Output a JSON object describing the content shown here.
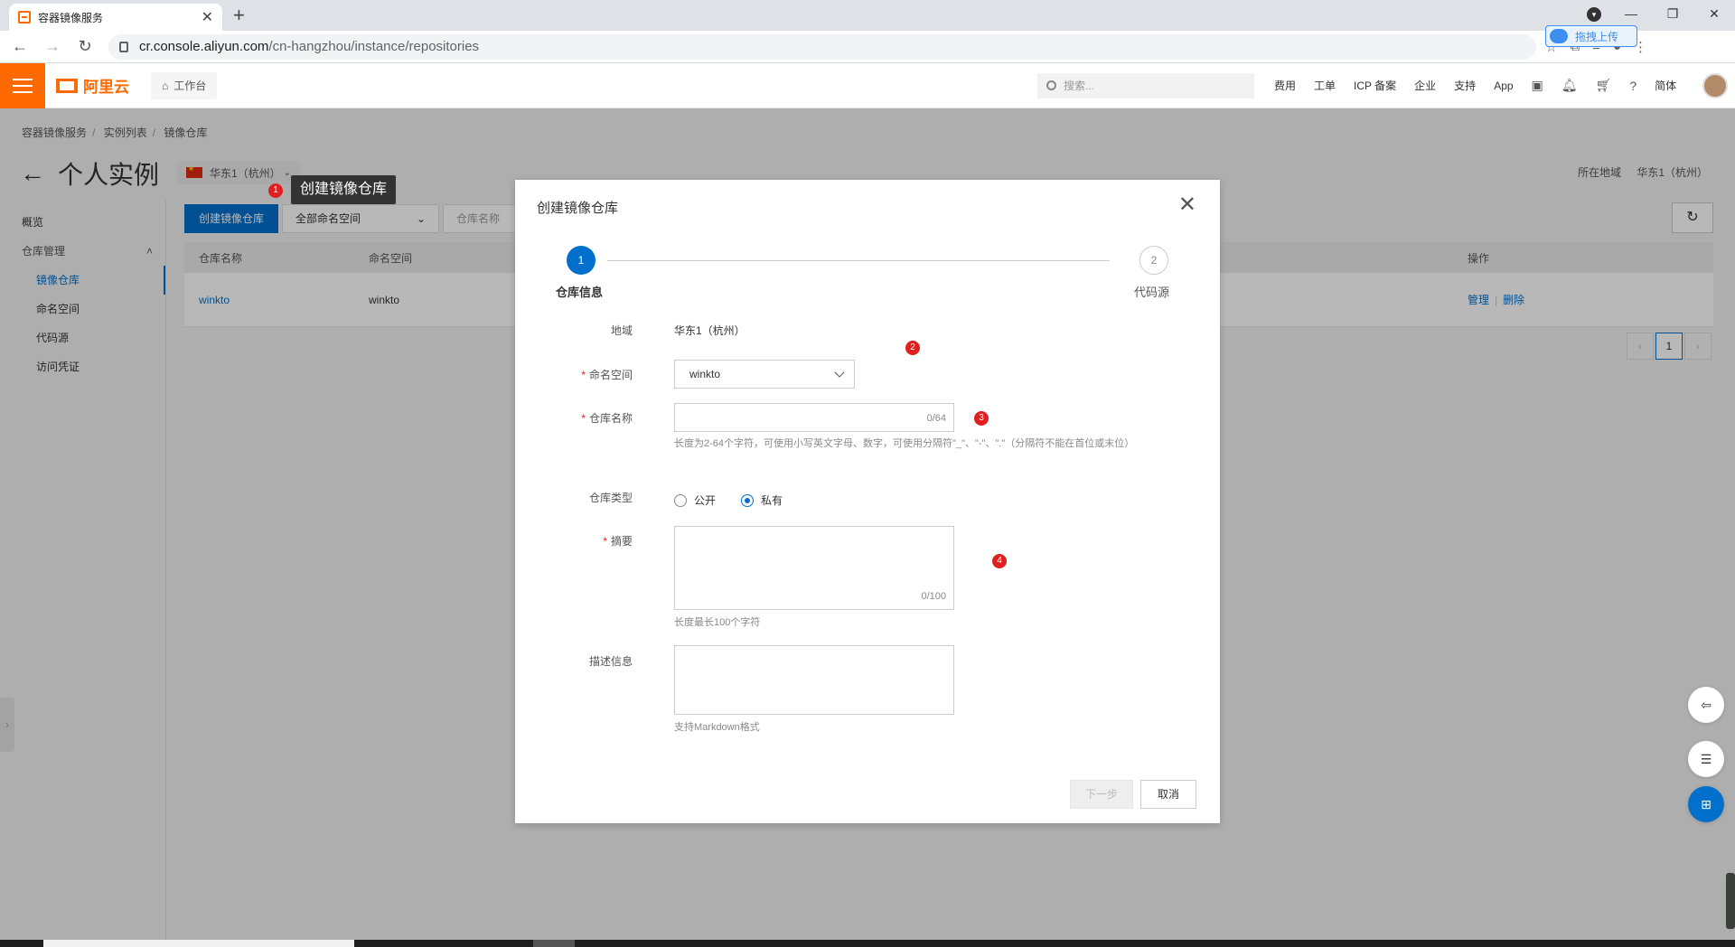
{
  "browser": {
    "tab_title": "容器镜像服务",
    "url_host": "cr.console.aliyun.com",
    "url_path": "/cn-hangzhou/instance/repositories",
    "upload_ext_label": "拖拽上传"
  },
  "console": {
    "logo_text": "阿里云",
    "workbench": "工作台",
    "search_placeholder": "搜索...",
    "nav": [
      "费用",
      "工单",
      "ICP 备案",
      "企业",
      "支持",
      "App"
    ],
    "lang": "简体"
  },
  "breadcrumb": [
    "容器镜像服务",
    "实例列表",
    "镜像仓库"
  ],
  "page": {
    "title": "个人实例",
    "region_select": "华东1（杭州）",
    "region_label": "所在地域",
    "region_value": "华东1（杭州）",
    "tooltip": "创建镜像仓库"
  },
  "sidebar": {
    "overview": "概览",
    "group": "仓库管理",
    "items": [
      "镜像仓库",
      "命名空间",
      "代码源",
      "访问凭证"
    ]
  },
  "main": {
    "create_button": "创建镜像仓库",
    "namespace_filter": "全部命名空间",
    "repo_name_placeholder": "仓库名称",
    "columns": {
      "name": "仓库名称",
      "namespace": "命名空间",
      "ops": "操作"
    },
    "rows": [
      {
        "name": "winkto",
        "namespace": "winkto",
        "op_manage": "管理",
        "op_delete": "删除"
      }
    ],
    "page": "1"
  },
  "dialog": {
    "title": "创建镜像仓库",
    "step1_num": "1",
    "step1_label": "仓库信息",
    "step2_num": "2",
    "step2_label": "代码源",
    "region_label": "地域",
    "region_value": "华东1（杭州）",
    "namespace_label": "命名空间",
    "namespace_value": "winkto",
    "repo_name_label": "仓库名称",
    "repo_name_counter": "0/64",
    "repo_name_help": "长度为2-64个字符，可使用小写英文字母、数字，可使用分隔符\"_\"、\"-\"、\".\"（分隔符不能在首位或末位）",
    "repo_type_label": "仓库类型",
    "repo_type_public": "公开",
    "repo_type_private": "私有",
    "summary_label": "摘要",
    "summary_counter": "0/100",
    "summary_help": "长度最长100个字符",
    "desc_label": "描述信息",
    "desc_help": "支持Markdown格式",
    "next_button": "下一步",
    "cancel_button": "取消"
  },
  "annotations": [
    "1",
    "2",
    "3",
    "4"
  ]
}
